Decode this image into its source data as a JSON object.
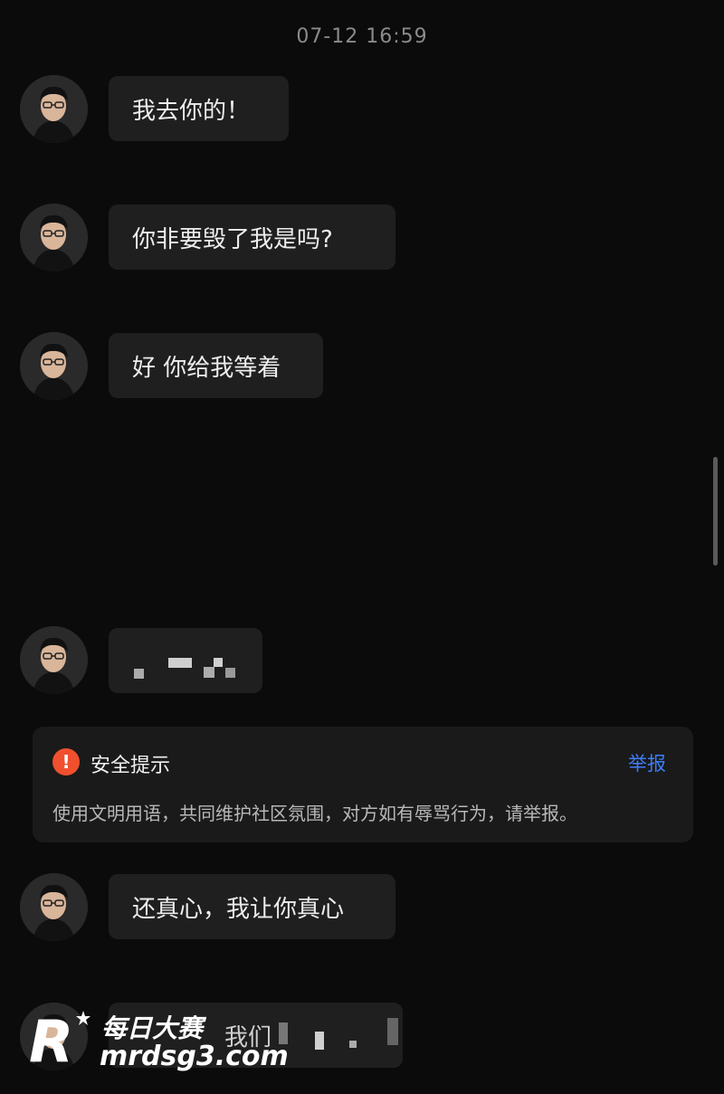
{
  "timestamp": "07-12 16:59",
  "messages": [
    {
      "text": "我去你的！"
    },
    {
      "text": "你非要毁了我是吗?"
    },
    {
      "text": "好 你给我等着"
    },
    {
      "text": ""
    },
    {
      "text": "还真心，我让你真心"
    },
    {
      "text": "我们"
    }
  ],
  "safety_notice": {
    "icon": "exclamation-icon",
    "title": "安全提示",
    "report_label": "举报",
    "body": "使用文明用语，共同维护社区氛围，对方如有辱骂行为，请举报。"
  },
  "watermark": {
    "line1": "每日大赛",
    "line2": "mrdsg3.com",
    "logo_letter": "R"
  },
  "colors": {
    "background": "#0b0b0b",
    "bubble": "#1f1f1f",
    "report_link": "#3d7df5",
    "warning": "#f0502e"
  }
}
